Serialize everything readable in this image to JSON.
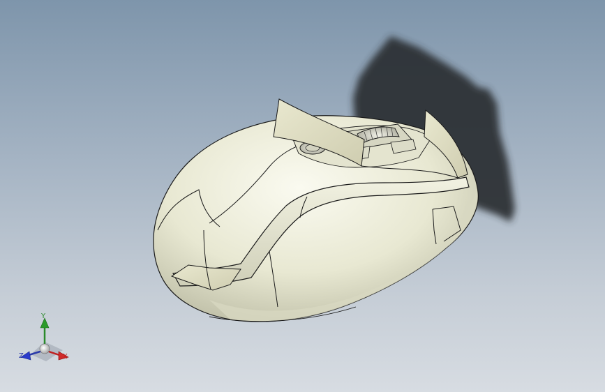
{
  "viewport": {
    "background_top": "#7e95ab",
    "background_bottom": "#d7dce2",
    "model_color": "#ebebd5",
    "edge_color": "#1a1a1a",
    "shadow_color": "#2b2f33"
  },
  "model": {
    "icon": "computer-mouse-3d-model",
    "parts": [
      "mouse-shell",
      "scroll-wheel",
      "side-grip-band",
      "front-flap",
      "top-flaps",
      "sensor-button"
    ]
  },
  "triad": {
    "y_label": "Y",
    "z_label": "Z",
    "x_label": "X",
    "y_color": "#2a8a2a",
    "z_color": "#2a3aaa",
    "x_color": "#c02020"
  }
}
